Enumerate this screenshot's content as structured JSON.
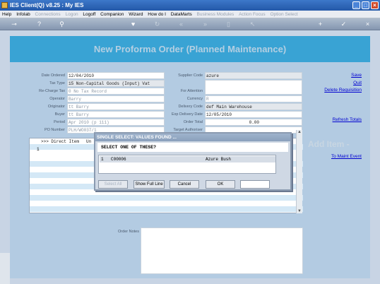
{
  "window": {
    "title": "IES Client(Q) v8.25 : My IES"
  },
  "menu": [
    {
      "label": "Help",
      "enabled": true
    },
    {
      "label": "Infolab",
      "enabled": true
    },
    {
      "label": "Connections",
      "enabled": false
    },
    {
      "label": "Logon",
      "enabled": false
    },
    {
      "label": "Logoff",
      "enabled": true
    },
    {
      "label": "Companion",
      "enabled": true
    },
    {
      "label": "Wizard",
      "enabled": true
    },
    {
      "label": "How do I",
      "enabled": true
    },
    {
      "label": "DataMarts",
      "enabled": true
    },
    {
      "label": "Business Modules",
      "enabled": false
    },
    {
      "label": "Action Focus",
      "enabled": false
    },
    {
      "label": "Option Select",
      "enabled": false
    }
  ],
  "header": {
    "title": "New Proforma Order (Planned Maintenance)"
  },
  "left_fields": {
    "date_ordered": {
      "label": "Date Ordered",
      "value": "12/04/2010"
    },
    "tax_type": {
      "label": "Tax Type",
      "value": "15 Non-Capital Goods (Input) Vat"
    },
    "recharge_tax": {
      "label": "Re-Charge Tax",
      "value": "0 No Tax Record"
    },
    "operator": {
      "label": "Operator",
      "value": "Barry"
    },
    "originator": {
      "label": "Originator",
      "value": "tt Barry"
    },
    "buyer": {
      "label": "Buyer",
      "value": "tt Barry"
    },
    "period": {
      "label": "Period",
      "value": "Apr 2010 (p 111)"
    },
    "po_number": {
      "label": "PO Number",
      "value": "PLH/WO037/1"
    }
  },
  "right_fields": {
    "supplier_code": {
      "label": "Supplier Code",
      "value": "azure"
    },
    "for_attention": {
      "label": "For Attention",
      "value": ""
    },
    "currency": {
      "label": "Currency",
      "value": "R"
    },
    "delivery_code": {
      "label": "Delivery Code",
      "value": "def Main Warehouse"
    },
    "exp_delivery_date": {
      "label": "Exp Delivery Date",
      "value": "12/05/2010"
    },
    "order_total": {
      "label": "Order Total",
      "value": "0.00"
    },
    "target_authoriser": {
      "label": "Target Authoriser",
      "value": ""
    }
  },
  "side_links": {
    "save": "Save",
    "quit": "Quit",
    "delete_requisition": "Delete Requisition",
    "refresh_totals": "Refresh Totals",
    "to_maint_event": "To Maint Event"
  },
  "add_item": {
    "title": "Add Item -"
  },
  "grid": {
    "header": ">>> Direct Item",
    "header_tail": "Un",
    "row_number": "1"
  },
  "order_notes": {
    "label": "Order Notes"
  },
  "dialog": {
    "title": "SINGLE SELECT: VALUES FOUND ...",
    "prompt": "SELECT ONE OF THESE?",
    "rows": [
      {
        "num": "1",
        "code": "C00006",
        "name": "Azure Bush"
      }
    ],
    "buttons": {
      "select_all": "Select All",
      "show_full_line": "Show Full Line",
      "cancel": "Cancel",
      "ok": "OK"
    },
    "input_value": ""
  },
  "colors": {
    "banner": "#39a3d4",
    "form_bg": "#b3cbe2",
    "link": "#0000d0"
  }
}
